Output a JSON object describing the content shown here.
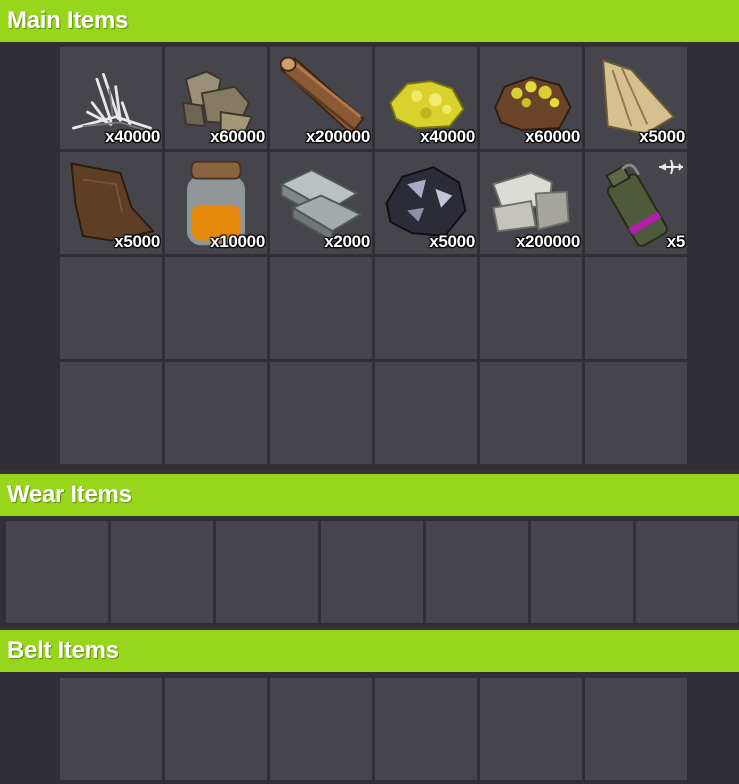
{
  "sections": {
    "main": {
      "title": "Main Items"
    },
    "wear": {
      "title": "Wear Items"
    },
    "belt": {
      "title": "Belt Items"
    }
  },
  "main_items": [
    {
      "icon": "wood-splinters-icon",
      "qty": "x40000"
    },
    {
      "icon": "metal-fragments-icon",
      "qty": "x60000"
    },
    {
      "icon": "wood-icon",
      "qty": "x200000"
    },
    {
      "icon": "sulfur-icon",
      "qty": "x40000"
    },
    {
      "icon": "sulfur-ore-icon",
      "qty": "x60000"
    },
    {
      "icon": "bone-fragments-icon",
      "qty": "x5000"
    },
    {
      "icon": "leather-icon",
      "qty": "x5000"
    },
    {
      "icon": "low-grade-fuel-icon",
      "qty": "x10000"
    },
    {
      "icon": "metal-bars-icon",
      "qty": "x2000"
    },
    {
      "icon": "charcoal-ore-icon",
      "qty": "x5000"
    },
    {
      "icon": "stones-icon",
      "qty": "x200000"
    },
    {
      "icon": "smoke-grenade-icon",
      "qty": "x5"
    }
  ],
  "colors": {
    "header": "#97d61a",
    "slot": "#45454b",
    "panel": "#2f2f35"
  }
}
